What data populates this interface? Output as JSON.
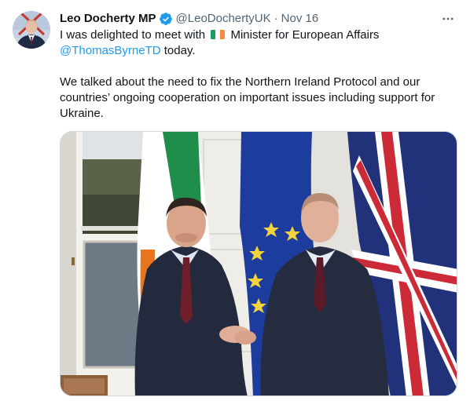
{
  "tweet": {
    "author": {
      "name": "Leo Docherty MP",
      "handle": "@LeoDochertyUK",
      "avatar_icon": "profile-photo",
      "verified_icon": "verified-badge-icon",
      "verified_color": "#1d9bf0"
    },
    "separator": "·",
    "date": "Nov 16",
    "more_icon": "more-options-icon",
    "text": {
      "line1_before_flag": "I was delighted to meet with",
      "flag_icon": "ireland-flag-emoji",
      "line1_after_flag": "Minister for European Affairs",
      "mention": "@ThomasByrneTD",
      "line2_after_mention": " today.",
      "paragraph2": "We talked about the need to fix the Northern Ireland Protocol and our countries’ ongoing cooperation on important issues including support for Ukraine."
    },
    "media": {
      "type": "photo",
      "subject": "two-men-shaking-hands-in-front-of-flags"
    }
  },
  "colors": {
    "text": "#0f1419",
    "secondary": "#536471",
    "link": "#1d9bf0",
    "border": "#cfd9de"
  }
}
